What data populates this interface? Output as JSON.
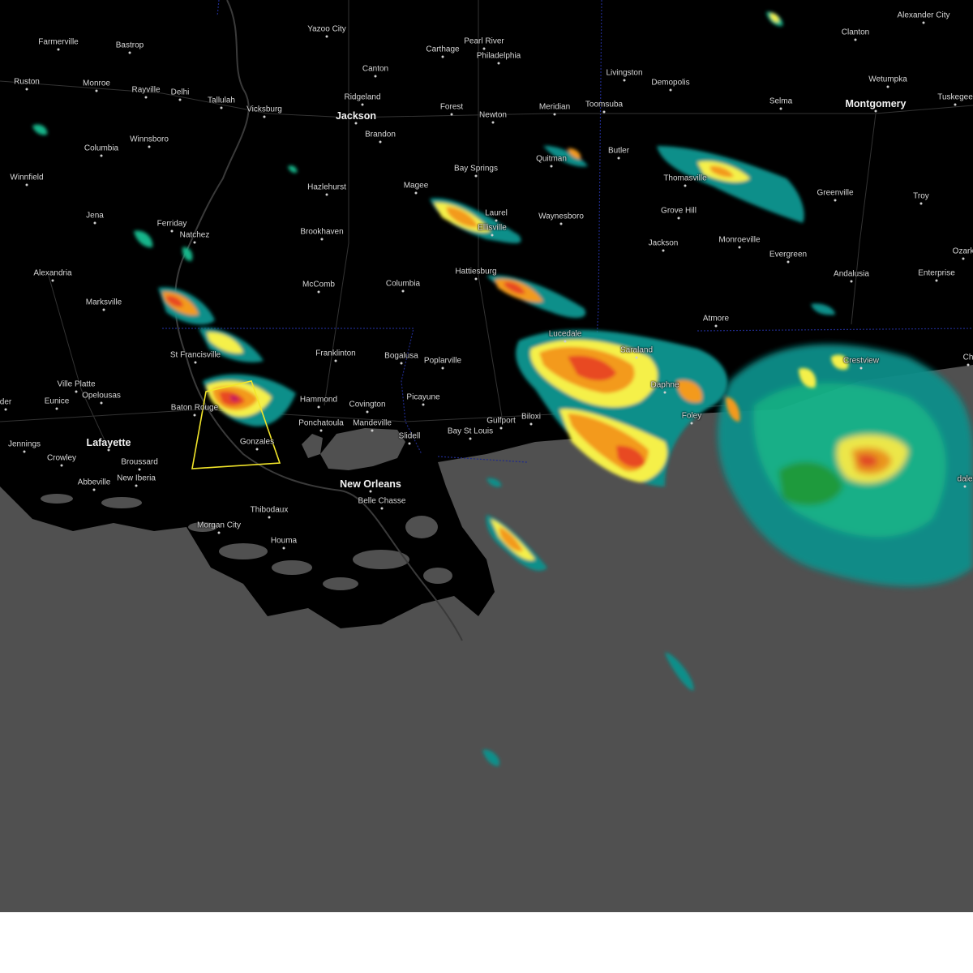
{
  "colors": {
    "land": "#000000",
    "water": "#505050",
    "warning_polygon": "#f2e52a",
    "state_border": "#1f2a8a",
    "radar_levels": [
      "#0a8f8a",
      "#12b58a",
      "#1f9e3a",
      "#f5f04a",
      "#f39a1e",
      "#e84a22",
      "#c81e5a"
    ]
  },
  "map": {
    "cities": [
      {
        "id": "farmerville",
        "name": "Farmerville"
      },
      {
        "id": "bastrop",
        "name": "Bastrop"
      },
      {
        "id": "yazoo-city",
        "name": "Yazoo City"
      },
      {
        "id": "carthage",
        "name": "Carthage"
      },
      {
        "id": "pearl-river",
        "name": "Pearl River"
      },
      {
        "id": "philadelphia",
        "name": "Philadelphia"
      },
      {
        "id": "alexander-city",
        "name": "Alexander City"
      },
      {
        "id": "clanton",
        "name": "Clanton"
      },
      {
        "id": "ruston",
        "name": "Ruston"
      },
      {
        "id": "monroe",
        "name": "Monroe"
      },
      {
        "id": "rayville",
        "name": "Rayville"
      },
      {
        "id": "delhi",
        "name": "Delhi"
      },
      {
        "id": "tallulah",
        "name": "Tallulah"
      },
      {
        "id": "vicksburg",
        "name": "Vicksburg"
      },
      {
        "id": "canton",
        "name": "Canton"
      },
      {
        "id": "ridgeland",
        "name": "Ridgeland"
      },
      {
        "id": "jackson",
        "name": "Jackson"
      },
      {
        "id": "brandon",
        "name": "Brandon"
      },
      {
        "id": "forest",
        "name": "Forest"
      },
      {
        "id": "newton",
        "name": "Newton"
      },
      {
        "id": "meridian",
        "name": "Meridian"
      },
      {
        "id": "toomsuba",
        "name": "Toomsuba"
      },
      {
        "id": "livingston",
        "name": "Livingston"
      },
      {
        "id": "demopolis",
        "name": "Demopolis"
      },
      {
        "id": "selma",
        "name": "Selma"
      },
      {
        "id": "montgomery",
        "name": "Montgomery"
      },
      {
        "id": "wetumpka",
        "name": "Wetumpka"
      },
      {
        "id": "tuskegee",
        "name": "Tuskegee"
      },
      {
        "id": "columbia-la",
        "name": "Columbia"
      },
      {
        "id": "winnsboro",
        "name": "Winnsboro"
      },
      {
        "id": "quitman",
        "name": "Quitman"
      },
      {
        "id": "butler",
        "name": "Butler"
      },
      {
        "id": "thomasville",
        "name": "Thomasville"
      },
      {
        "id": "greenville",
        "name": "Greenville"
      },
      {
        "id": "troy",
        "name": "Troy"
      },
      {
        "id": "winnfield",
        "name": "Winnfield"
      },
      {
        "id": "hazlehurst",
        "name": "Hazlehurst"
      },
      {
        "id": "magee",
        "name": "Magee"
      },
      {
        "id": "bay-springs",
        "name": "Bay Springs"
      },
      {
        "id": "laurel",
        "name": "Laurel"
      },
      {
        "id": "ellisville",
        "name": "Ellisville"
      },
      {
        "id": "waynesboro",
        "name": "Waynesboro"
      },
      {
        "id": "grove-hill",
        "name": "Grove Hill"
      },
      {
        "id": "jena",
        "name": "Jena"
      },
      {
        "id": "ferriday",
        "name": "Ferriday"
      },
      {
        "id": "natchez",
        "name": "Natchez"
      },
      {
        "id": "brookhaven",
        "name": "Brookhaven"
      },
      {
        "id": "jackson-al",
        "name": "Jackson"
      },
      {
        "id": "monroeville",
        "name": "Monroeville"
      },
      {
        "id": "evergreen",
        "name": "Evergreen"
      },
      {
        "id": "alexandria",
        "name": "Alexandria"
      },
      {
        "id": "mccomb",
        "name": "McComb"
      },
      {
        "id": "columbia-ms",
        "name": "Columbia"
      },
      {
        "id": "hattiesburg",
        "name": "Hattiesburg"
      },
      {
        "id": "andalusia",
        "name": "Andalusia"
      },
      {
        "id": "enterprise",
        "name": "Enterprise"
      },
      {
        "id": "ozark",
        "name": "Ozark"
      },
      {
        "id": "marksville",
        "name": "Marksville"
      },
      {
        "id": "atmore",
        "name": "Atmore"
      },
      {
        "id": "lucedale",
        "name": "Lucedale"
      },
      {
        "id": "saraland",
        "name": "Saraland"
      },
      {
        "id": "st-francisville",
        "name": "St Francisville"
      },
      {
        "id": "franklinton",
        "name": "Franklinton"
      },
      {
        "id": "bogalusa",
        "name": "Bogalusa"
      },
      {
        "id": "poplarville",
        "name": "Poplarville"
      },
      {
        "id": "crestview",
        "name": "Crestview"
      },
      {
        "id": "ville-platte",
        "name": "Ville Platte"
      },
      {
        "id": "opelousas",
        "name": "Opelousas"
      },
      {
        "id": "eunice",
        "name": "Eunice"
      },
      {
        "id": "baton-rouge",
        "name": "Baton Rouge"
      },
      {
        "id": "hammond",
        "name": "Hammond"
      },
      {
        "id": "covington",
        "name": "Covington"
      },
      {
        "id": "picayune",
        "name": "Picayune"
      },
      {
        "id": "ponchatoula",
        "name": "Ponchatoula"
      },
      {
        "id": "mandeville",
        "name": "Mandeville"
      },
      {
        "id": "gulfport",
        "name": "Gulfport"
      },
      {
        "id": "biloxi",
        "name": "Biloxi"
      },
      {
        "id": "daphne",
        "name": "Daphne"
      },
      {
        "id": "foley",
        "name": "Foley"
      },
      {
        "id": "slidell",
        "name": "Slidell"
      },
      {
        "id": "bay-st-louis",
        "name": "Bay St Louis"
      },
      {
        "id": "jennings",
        "name": "Jennings"
      },
      {
        "id": "lafayette",
        "name": "Lafayette"
      },
      {
        "id": "gonzales",
        "name": "Gonzales"
      },
      {
        "id": "crowley",
        "name": "Crowley"
      },
      {
        "id": "broussard",
        "name": "Broussard"
      },
      {
        "id": "new-orleans",
        "name": "New Orleans"
      },
      {
        "id": "abbeville",
        "name": "Abbeville"
      },
      {
        "id": "new-iberia",
        "name": "New Iberia"
      },
      {
        "id": "belle-chasse",
        "name": "Belle Chasse"
      },
      {
        "id": "thibodaux",
        "name": "Thibodaux"
      },
      {
        "id": "morgan-city",
        "name": "Morgan City"
      },
      {
        "id": "houma",
        "name": "Houma"
      },
      {
        "id": "ridder",
        "name": "der"
      },
      {
        "id": "ch-edge",
        "name": "Ch"
      },
      {
        "id": "dale-edge",
        "name": "dale"
      }
    ]
  }
}
